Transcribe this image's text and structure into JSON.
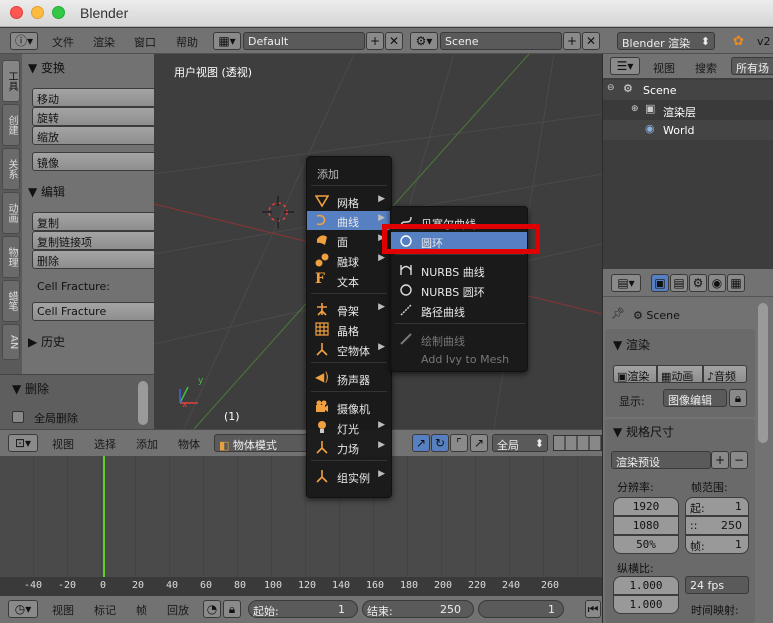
{
  "window": {
    "title": "Blender"
  },
  "info_header": {
    "menus": [
      "文件",
      "渲染",
      "窗口",
      "帮助"
    ],
    "layout_value": "Default",
    "scene_value": "Scene",
    "engine_value": "Blender 渲染",
    "version_partial": "v2"
  },
  "tool_tabs": [
    "工具",
    "创建",
    "关系",
    "动画",
    "物理",
    "蜡笔",
    "AN"
  ],
  "tool_shelf": {
    "transform_header": "变换",
    "transform_buttons": [
      "移动",
      "旋转",
      "缩放"
    ],
    "mirror_button": "镜像",
    "edit_header": "编辑",
    "edit_buttons": [
      "复制",
      "复制链接项",
      "删除"
    ],
    "cell_fracture_label": "Cell Fracture:",
    "cell_fracture_button": "Cell Fracture",
    "history_header": "历史",
    "delete_header": "删除",
    "global_delete_label": "全局删除"
  },
  "viewport": {
    "title": "用户视图 (透视)",
    "frame_label": "(1)",
    "axis_y": "y",
    "axis_x": "x"
  },
  "add_menu": {
    "title": "添加",
    "items": [
      {
        "label": "网格",
        "icon": "mesh-icon",
        "submenu": true
      },
      {
        "label": "曲线",
        "icon": "curve-icon",
        "submenu": true
      },
      {
        "label": "面",
        "icon": "surface-icon",
        "submenu": true
      },
      {
        "label": "融球",
        "icon": "metaball-icon",
        "submenu": true
      },
      {
        "label": "文本",
        "icon": "text-icon",
        "submenu": false
      },
      {
        "label": "骨架",
        "icon": "armature-icon",
        "submenu": true
      },
      {
        "label": "晶格",
        "icon": "lattice-icon",
        "submenu": false
      },
      {
        "label": "空物体",
        "icon": "empty-icon",
        "submenu": true
      },
      {
        "label": "扬声器",
        "icon": "speaker-icon",
        "submenu": false
      },
      {
        "label": "摄像机",
        "icon": "camera-icon",
        "submenu": false
      },
      {
        "label": "灯光",
        "icon": "lamp-icon",
        "submenu": true
      },
      {
        "label": "力场",
        "icon": "forcefield-icon",
        "submenu": true
      },
      {
        "label": "组实例",
        "icon": "group-icon",
        "submenu": true
      }
    ]
  },
  "curve_submenu": {
    "items": [
      "贝塞尔曲线",
      "圆环",
      "NURBS 曲线",
      "NURBS 圆环",
      "路径曲线"
    ],
    "disabled_items": [
      "绘制曲线",
      "Add Ivy to Mesh"
    ]
  },
  "timeline_header": {
    "menus": [
      "视图",
      "选择",
      "添加",
      "物体"
    ],
    "mode_value": "物体模式",
    "pivot_value": "全局"
  },
  "timeline": {
    "ticks": [
      "-40",
      "-20",
      "0",
      "20",
      "40",
      "60",
      "80",
      "100",
      "120",
      "140",
      "160",
      "180",
      "200",
      "220",
      "240",
      "260"
    ]
  },
  "timeline_footer": {
    "menus": [
      "视图",
      "标记",
      "帧",
      "回放"
    ],
    "start_label": "起始:",
    "start_value": "1",
    "end_label": "结束:",
    "end_value": "250",
    "current_value": "1"
  },
  "outliner": {
    "menus": [
      "视图",
      "搜索"
    ],
    "filter_value": "所有场",
    "tree": [
      "Scene",
      "渲染层",
      "World"
    ]
  },
  "properties": {
    "context_label": "Scene",
    "render_header": "渲染",
    "render_buttons": [
      "渲染",
      "动画",
      "音频"
    ],
    "display_label": "显示:",
    "display_value": "图像编辑",
    "dimensions_header": "规格尺寸",
    "preset_value": "渲染预设",
    "resolution_label": "分辨率:",
    "res_x": "1920",
    "res_y": "1080",
    "res_pct": "50%",
    "frame_range_label": "帧范围:",
    "frame_start": "起:",
    "frame_start_val": "1",
    "frame_end": "::",
    "frame_end_val": "250",
    "frame_step": "帧:",
    "frame_step_val": "1",
    "aspect_label": "纵横比:",
    "aspect_val": "1.000",
    "aspect_val2": "1.000",
    "fps_value": "24 fps",
    "time_remap": "时间映射:"
  },
  "colors": {
    "highlight": "#e00000",
    "selection": "#5680c2",
    "playhead": "#60d020"
  }
}
